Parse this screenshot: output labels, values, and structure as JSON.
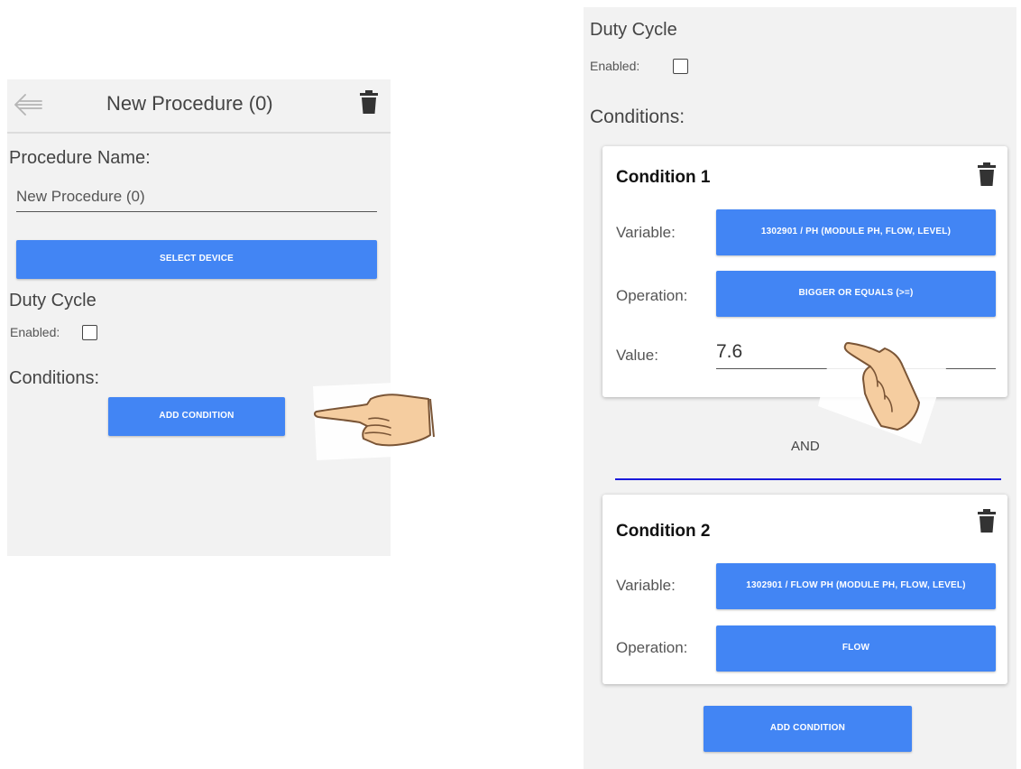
{
  "left_screen": {
    "header": {
      "title": "New Procedure (0)",
      "back_icon": "arrow-left-icon",
      "delete_icon": "trash-icon"
    },
    "procedure_name_label": "Procedure Name:",
    "procedure_name_value": "New Procedure (0)",
    "select_device_label": "SELECT DEVICE",
    "duty_cycle_label": "Duty Cycle",
    "enabled_label": "Enabled:",
    "enabled_checked": false,
    "conditions_label": "Conditions:",
    "add_condition_label": "ADD CONDITION"
  },
  "right_screen": {
    "duty_cycle_label": "Duty Cycle",
    "enabled_label": "Enabled:",
    "enabled_checked": false,
    "conditions_label": "Conditions:",
    "conditions": [
      {
        "title": "Condition 1",
        "variable_label": "Variable:",
        "variable_value": "1302901 / PH (MODULE PH, FLOW, LEVEL)",
        "operation_label": "Operation:",
        "operation_value": "BIGGER OR EQUALS (>=)",
        "value_label": "Value:",
        "value": "7.6"
      },
      {
        "title": "Condition 2",
        "variable_label": "Variable:",
        "variable_value": "1302901 / FLOW PH (MODULE PH, FLOW, LEVEL)",
        "operation_label": "Operation:",
        "operation_value": "FLOW"
      }
    ],
    "join_label": "AND",
    "add_condition_label": "ADD CONDITION"
  },
  "colors": {
    "button_blue": "#4285f4",
    "panel_bg": "#f2f2f2",
    "and_line": "#1a1adb"
  },
  "icons": [
    "arrow-left-icon",
    "trash-icon",
    "checkbox-icon",
    "pointing-hand-icon"
  ]
}
